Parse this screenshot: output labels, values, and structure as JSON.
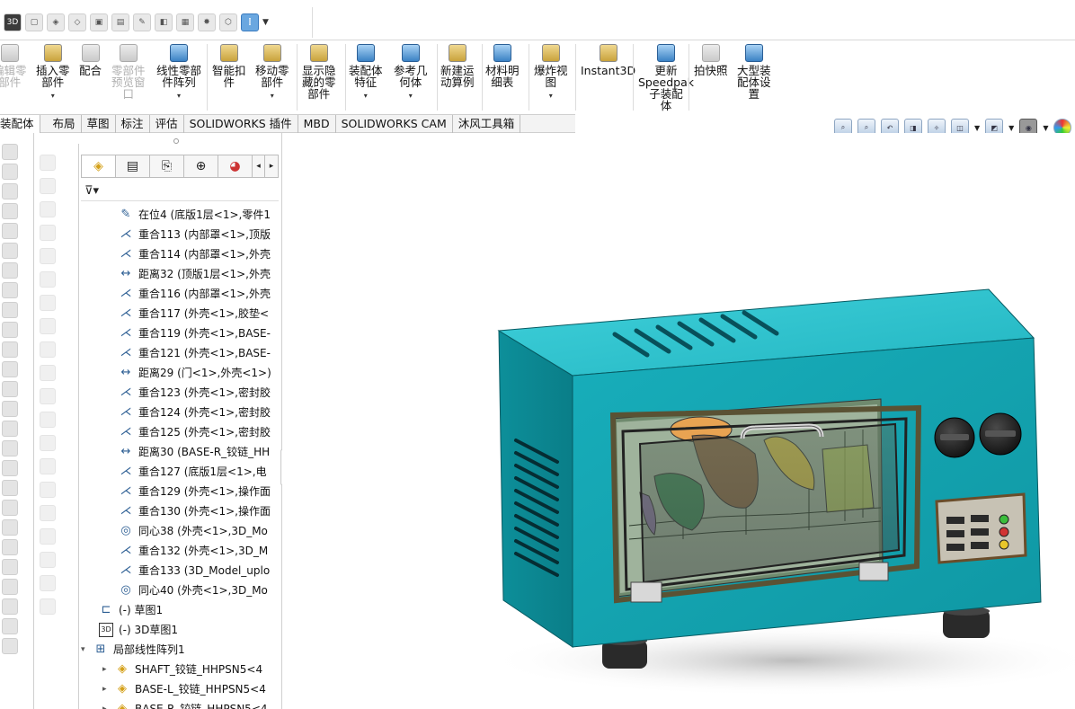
{
  "quick_toolbar": {
    "icon_names": [
      "3d-icon",
      "part-icon",
      "assembly-icon",
      "component-icon",
      "smart-icon",
      "instance-icon",
      "sketch-icon",
      "view-icon",
      "save-icon",
      "explode-icon",
      "motion-icon",
      "mate-icon",
      "dropdown-icon"
    ]
  },
  "command_manager": {
    "buttons": [
      {
        "label": "编辑零\n部件",
        "disabled": true
      },
      {
        "label": "插入零\n部件",
        "disabled": false
      },
      {
        "label": "配合",
        "disabled": false
      },
      {
        "label": "零部件\n预览窗\n口",
        "disabled": true
      },
      {
        "label": "线性零部\n件阵列",
        "disabled": false
      },
      {
        "label": "智能扣\n件",
        "disabled": false
      },
      {
        "label": "移动零\n部件",
        "disabled": false
      },
      {
        "label": "显示隐\n藏的零\n部件",
        "disabled": false
      },
      {
        "label": "装配体\n特征",
        "disabled": false
      },
      {
        "label": "参考几\n何体",
        "disabled": false
      },
      {
        "label": "新建运\n动算例",
        "disabled": false
      },
      {
        "label": "材料明\n细表",
        "disabled": false
      },
      {
        "label": "爆炸视\n图",
        "disabled": false
      },
      {
        "label": "Instant3D",
        "disabled": false
      },
      {
        "label": "更新\nSpeedpak\n子装配\n体",
        "disabled": false
      },
      {
        "label": "拍快照",
        "disabled": false
      },
      {
        "label": "大型装\n配体设\n置",
        "disabled": false
      }
    ]
  },
  "tabs": [
    "装配体",
    "布局",
    "草图",
    "标注",
    "评估",
    "SOLIDWORKS 插件",
    "MBD",
    "SOLIDWORKS CAM",
    "沐风工具箱"
  ],
  "active_tab": "装配体",
  "feature_tree": {
    "rows": [
      {
        "icon": "in-place-icon",
        "text": "在位4 (底版1层<1>,零件1"
      },
      {
        "icon": "coincident-icon",
        "text": "重合113 (内部罩<1>,顶版"
      },
      {
        "icon": "coincident-icon",
        "text": "重合114 (内部罩<1>,外壳"
      },
      {
        "icon": "distance-icon",
        "text": "距离32 (顶版1层<1>,外壳"
      },
      {
        "icon": "coincident-icon",
        "text": "重合116 (内部罩<1>,外壳"
      },
      {
        "icon": "coincident-icon",
        "text": "重合117 (外壳<1>,胶垫<"
      },
      {
        "icon": "coincident-icon",
        "text": "重合119 (外壳<1>,BASE-"
      },
      {
        "icon": "coincident-icon",
        "text": "重合121 (外壳<1>,BASE-"
      },
      {
        "icon": "distance-icon",
        "text": "距离29 (门<1>,外壳<1>)"
      },
      {
        "icon": "coincident-icon",
        "text": "重合123 (外壳<1>,密封胶"
      },
      {
        "icon": "coincident-icon",
        "text": "重合124 (外壳<1>,密封胶"
      },
      {
        "icon": "coincident-icon",
        "text": "重合125 (外壳<1>,密封胶"
      },
      {
        "icon": "distance-icon",
        "text": "距离30 (BASE-R_铰链_HH"
      },
      {
        "icon": "coincident-icon",
        "text": "重合127 (底版1层<1>,电"
      },
      {
        "icon": "coincident-icon",
        "text": "重合129 (外壳<1>,操作面"
      },
      {
        "icon": "coincident-icon",
        "text": "重合130 (外壳<1>,操作面"
      },
      {
        "icon": "concentric-icon",
        "text": "同心38 (外壳<1>,3D_Mo"
      },
      {
        "icon": "coincident-icon",
        "text": "重合132 (外壳<1>,3D_M"
      },
      {
        "icon": "coincident-icon",
        "text": "重合133 (3D_Model_uplo"
      },
      {
        "icon": "concentric-icon",
        "text": "同心40 (外壳<1>,3D_Mo"
      },
      {
        "icon": "sketch-icon",
        "text": "(-) 草图1"
      },
      {
        "icon": "3d-sketch-icon",
        "text": "(-) 3D草图1"
      },
      {
        "icon": "linear-pattern-icon",
        "text": "局部线性阵列1"
      },
      {
        "icon": "part-icon",
        "text": "SHAFT_铰链_HHPSN5<4"
      },
      {
        "icon": "part-icon",
        "text": "BASE-L_铰链_HHPSN5<4"
      },
      {
        "icon": "part-icon",
        "text": "BASE-R_铰链_HHPSN5<4"
      }
    ]
  },
  "colors": {
    "oven_body": "#12a3b0",
    "oven_body_dark": "#0b7f8b",
    "oven_top": "#28c0cc",
    "door_frame": "#5a5234",
    "panel_bg": "#c7c2b4"
  }
}
